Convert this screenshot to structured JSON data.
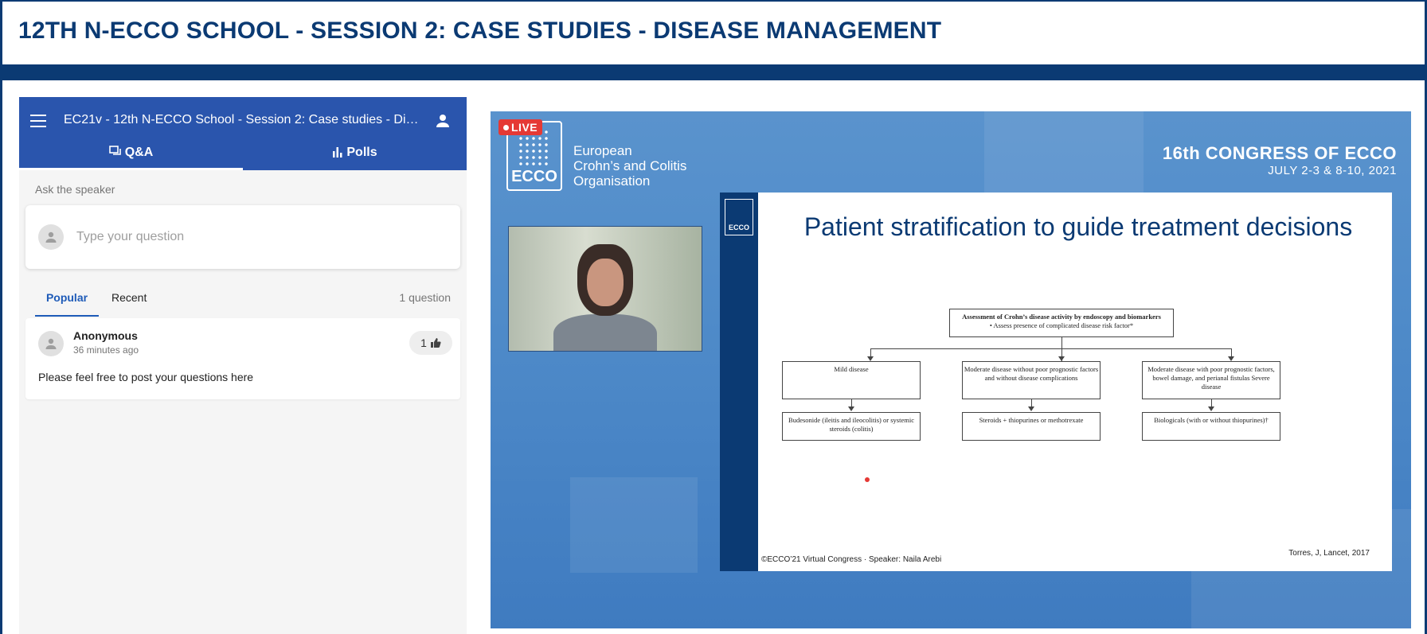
{
  "page": {
    "title": "12TH N-ECCO SCHOOL - SESSION 2: CASE STUDIES - DISEASE MANAGEMENT"
  },
  "qa": {
    "event_title": "EC21v - 12th N-ECCO School - Session 2: Case studies - Disease management",
    "tabs": [
      {
        "label": "Q&A",
        "icon": "chat-icon"
      },
      {
        "label": "Polls",
        "icon": "bar-chart-icon"
      }
    ],
    "ask_label": "Ask the speaker",
    "input_placeholder": "Type your question",
    "sort_tabs": [
      "Popular",
      "Recent"
    ],
    "question_count": "1 question",
    "questions": [
      {
        "author": "Anonymous",
        "time": "36 minutes ago",
        "votes": "1",
        "text": "Please feel free to post your questions here"
      }
    ]
  },
  "video": {
    "live_label": "LIVE",
    "logo_text": "ECCO",
    "org_name": [
      "European",
      "Crohn’s and Colitis",
      "Organisation"
    ],
    "congress_title": "16th CONGRESS OF ECCO",
    "congress_dates": "JULY 2-3 & 8-10, 2021",
    "slide": {
      "logo_text": "ECCO",
      "title": "Patient stratification to guide treatment decisions",
      "top_box": [
        "Assessment of Crohn’s disease activity by endoscopy and biomarkers",
        "• Assess presence of complicated disease risk factor*"
      ],
      "branches": [
        {
          "condition": "Mild disease",
          "treatment": "Budesonide (ileitis and ileocolitis) or systemic steroids (colitis)"
        },
        {
          "condition": "Moderate disease without poor prognostic factors and without disease complications",
          "treatment": "Steroids + thiopurines or methotrexate"
        },
        {
          "condition": "Moderate disease with poor prognostic factors, bowel damage, and perianal fistulas Severe disease",
          "treatment": "Biologicals (with or without thiopurines)†"
        }
      ],
      "footer": "©ECCO’21 Virtual Congress ·  Speaker: Naila Arebi",
      "citation": "Torres, J, Lancet, 2017"
    }
  }
}
